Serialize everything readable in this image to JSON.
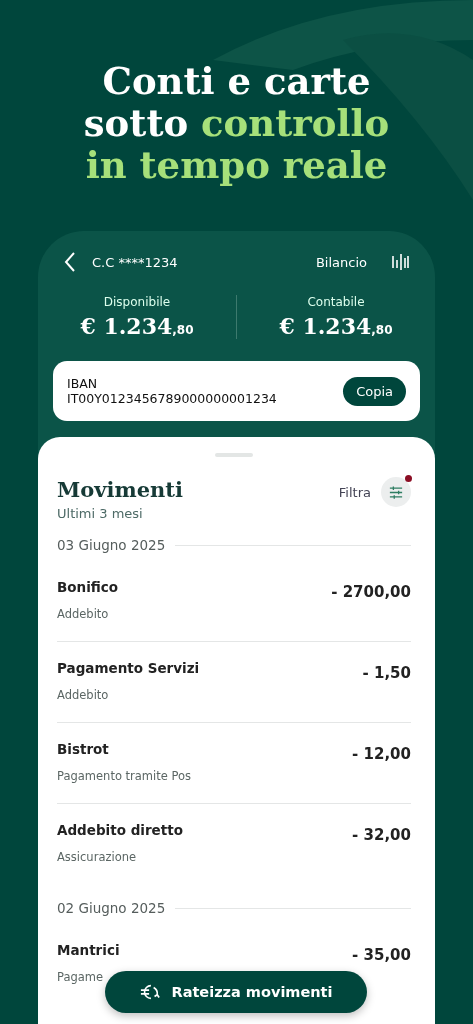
{
  "headline": [
    [
      {
        "text": "Conti e carte",
        "accent": false
      }
    ],
    [
      {
        "text": "sotto ",
        "accent": false
      },
      {
        "text": "controllo",
        "accent": true
      }
    ],
    [
      {
        "text": "in tempo reale",
        "accent": true
      }
    ]
  ],
  "account": {
    "name": "C.C ****1234",
    "balance_link": "Bilancio"
  },
  "balances": [
    {
      "label": "Disponibile",
      "amount": "€ 1.234",
      "cents": ",80"
    },
    {
      "label": "Contabile",
      "amount": "€ 1.234",
      "cents": ",80"
    }
  ],
  "iban": {
    "label": "IBAN",
    "value": "IT00Y0123456789000000001234",
    "button": "Copia"
  },
  "movements": {
    "title": "Movimenti",
    "subtitle": "Ultimi 3 mesi",
    "filter_label": "Filtra",
    "filter_active": true,
    "groups": [
      {
        "date": "03 Giugno 2025",
        "items": [
          {
            "title": "Bonifico",
            "detail": "Addebito",
            "amount": "- 2700,00"
          },
          {
            "title": "Pagamento Servizi",
            "detail": "Addebito",
            "amount": "- 1,50"
          },
          {
            "title": "Bistrot",
            "detail": "Pagamento tramite Pos",
            "amount": "- 12,00"
          },
          {
            "title": "Addebito diretto",
            "detail": "Assicurazione",
            "amount": "- 32,00"
          }
        ]
      },
      {
        "date": "02 Giugno 2025",
        "items": [
          {
            "title": "Mantrici",
            "detail": "Pagame",
            "amount": "- 35,00"
          }
        ]
      }
    ]
  },
  "action_button": "Rateizza movimenti"
}
